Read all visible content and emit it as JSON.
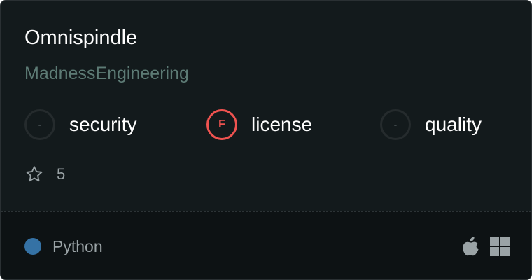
{
  "repo": {
    "name": "Omnispindle",
    "owner": "MadnessEngineering"
  },
  "scores": [
    {
      "label": "security",
      "grade": "-",
      "grade_color": "#252b2d"
    },
    {
      "label": "license",
      "grade": "F",
      "grade_color": "#ef5350"
    },
    {
      "label": "quality",
      "grade": "-",
      "grade_color": "#252b2d"
    }
  ],
  "stars": {
    "icon": "star-icon",
    "count": "5"
  },
  "footer": {
    "language": "Python",
    "language_color": "#3572a5",
    "platforms": [
      "apple-icon",
      "windows-icon"
    ]
  }
}
